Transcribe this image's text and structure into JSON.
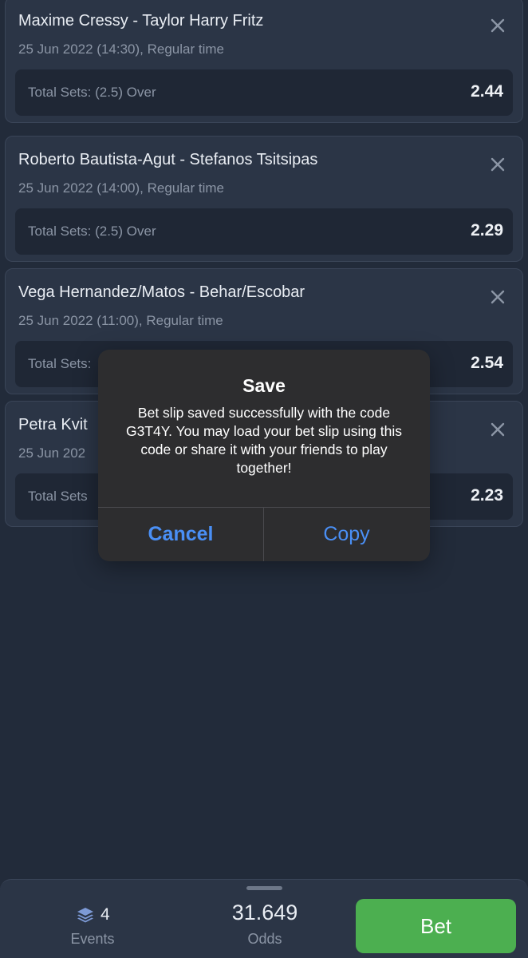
{
  "bets": [
    {
      "match": "Maxime Cressy - Taylor Harry Fritz",
      "datetime": "25 Jun 2022 (14:30), Regular time",
      "market": "Total Sets: (2.5) Over",
      "odds": "2.44"
    },
    {
      "match": "Roberto Bautista-Agut - Stefanos Tsitsipas",
      "datetime": "25 Jun 2022 (14:00), Regular time",
      "market": "Total Sets: (2.5) Over",
      "odds": "2.29"
    },
    {
      "match": "Vega Hernandez/Matos - Behar/Escobar",
      "datetime": "25 Jun 2022 (11:00), Regular time",
      "market": "Total Sets:",
      "odds": "2.54"
    },
    {
      "match": "Petra Kvit",
      "datetime": "25 Jun 202",
      "market": "Total Sets",
      "odds": "2.23"
    }
  ],
  "dialog": {
    "title": "Save",
    "message": "Bet slip saved successfully with the code G3T4Y. You may load your bet slip using this code or share it with your friends to play together!",
    "cancel_label": "Cancel",
    "copy_label": "Copy"
  },
  "summary": {
    "events_count": "4",
    "events_label": "Events",
    "odds_value": "31.649",
    "odds_label": "Odds",
    "bet_label": "Bet"
  },
  "icons": {
    "close": "close-icon",
    "events": "layers-icon"
  },
  "colors": {
    "background": "#222b3a",
    "card": "#2b3546",
    "accent_blue": "#4a8ff5",
    "bet_green": "#4caf50"
  }
}
